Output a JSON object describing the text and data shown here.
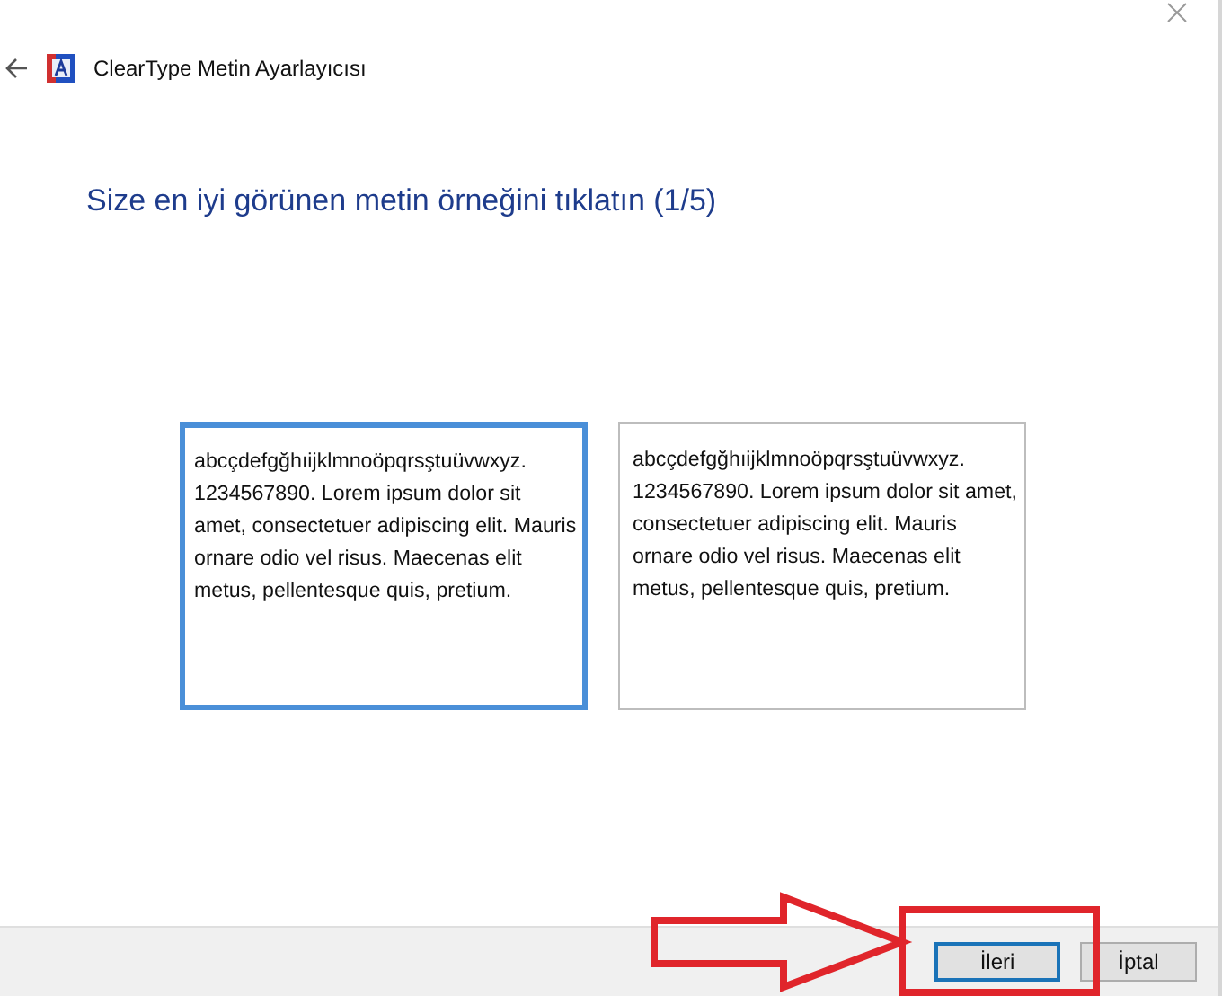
{
  "window": {
    "title": "ClearType Metin Ayarlayıcısı"
  },
  "heading": "Size en iyi görünen metin örneğini tıklatın (1/5)",
  "samples": [
    {
      "text": "abcçdefgğhıijklmnoöpqrsştuüvwxyz. 1234567890. Lorem ipsum dolor sit amet, consectetuer adipiscing elit. Mauris ornare odio vel risus. Maecenas elit metus, pellentesque quis, pretium.",
      "selected": true
    },
    {
      "text": "abcçdefgğhıijklmnoöpqrsştuüvwxyz. 1234567890. Lorem ipsum dolor sit amet, consectetuer adipiscing elit. Mauris ornare odio vel risus. Maecenas elit metus, pellentesque quis, pretium.",
      "selected": false
    }
  ],
  "buttons": [
    {
      "label": "İleri",
      "kind": "default"
    },
    {
      "label": "İptal",
      "kind": "normal"
    }
  ]
}
